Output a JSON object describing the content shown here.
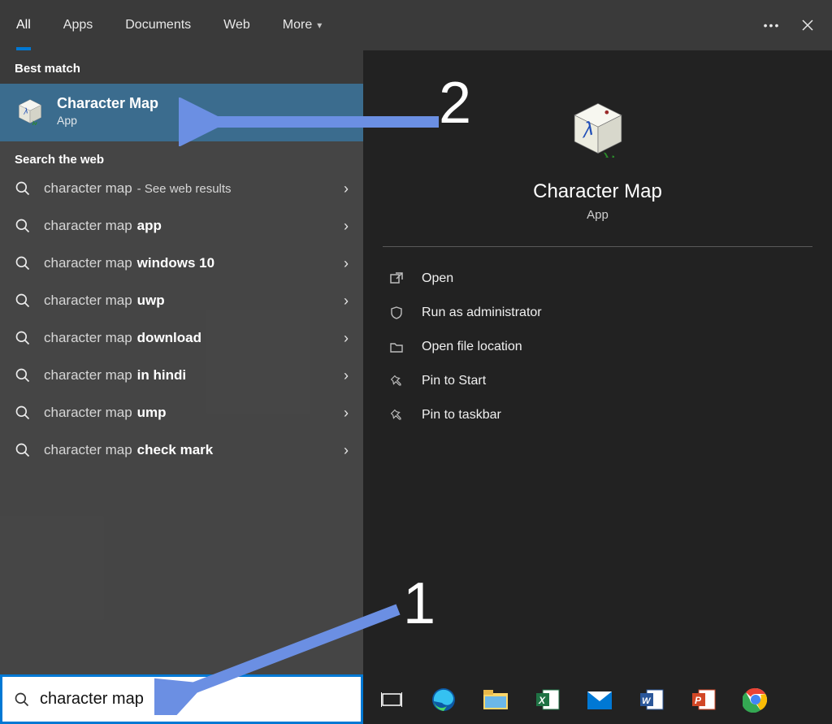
{
  "colors": {
    "accent": "#0078d4",
    "annotation": "#6b8fe3"
  },
  "tabs": {
    "items": [
      {
        "label": "All",
        "active": true
      },
      {
        "label": "Apps",
        "active": false
      },
      {
        "label": "Documents",
        "active": false
      },
      {
        "label": "Web",
        "active": false
      },
      {
        "label": "More",
        "active": false,
        "hasDropdown": true
      }
    ]
  },
  "left": {
    "bestMatchHeader": "Best match",
    "bestMatch": {
      "title": "Character Map",
      "subtitle": "App"
    },
    "webHeader": "Search the web",
    "webItems": [
      {
        "prefix": "character map",
        "bold": "",
        "suffix": " - See web results"
      },
      {
        "prefix": "character map ",
        "bold": "app",
        "suffix": ""
      },
      {
        "prefix": "character map ",
        "bold": "windows 10",
        "suffix": ""
      },
      {
        "prefix": "character map ",
        "bold": "uwp",
        "suffix": ""
      },
      {
        "prefix": "character map ",
        "bold": "download",
        "suffix": ""
      },
      {
        "prefix": "character map ",
        "bold": "in hindi",
        "suffix": ""
      },
      {
        "prefix": "character map ",
        "bold": "ump",
        "suffix": ""
      },
      {
        "prefix": "character map ",
        "bold": "check mark",
        "suffix": ""
      }
    ]
  },
  "preview": {
    "title": "Character Map",
    "subtitle": "App",
    "actions": [
      {
        "icon": "open",
        "label": "Open"
      },
      {
        "icon": "admin",
        "label": "Run as administrator"
      },
      {
        "icon": "folder",
        "label": "Open file location"
      },
      {
        "icon": "pin",
        "label": "Pin to Start"
      },
      {
        "icon": "pin",
        "label": "Pin to taskbar"
      }
    ]
  },
  "search": {
    "value": "character map"
  },
  "taskbar": {
    "icons": [
      "taskview",
      "edge",
      "explorer",
      "excel",
      "mail",
      "word",
      "powerpoint",
      "chrome"
    ]
  },
  "annotations": {
    "num2": "2",
    "num1": "1"
  }
}
